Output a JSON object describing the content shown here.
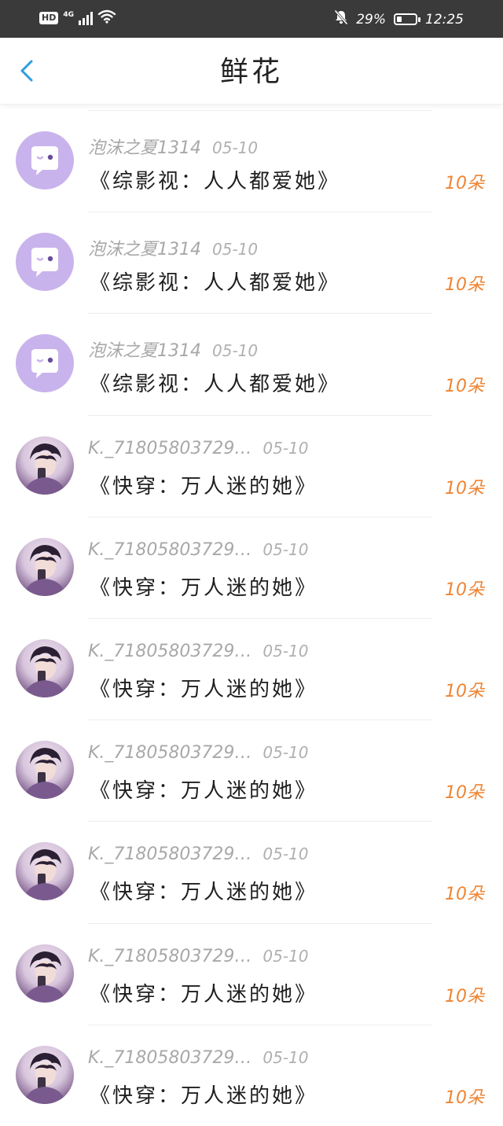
{
  "status_bar": {
    "hd": "HD",
    "network": "4G",
    "battery_percent": "29%",
    "battery_level": 0.29,
    "time": "12:25",
    "icons": [
      "hd-icon",
      "signal-icon",
      "wifi-icon",
      "bell-mute-icon",
      "battery-icon"
    ]
  },
  "header": {
    "title": "鲜花",
    "back_icon": "chevron-left-icon",
    "accent_color": "#2d9de0"
  },
  "colors": {
    "count_color": "#ef8433",
    "default_avatar_bg": "#c9b3ec"
  },
  "items": [
    {
      "user": "泡沫之夏1314",
      "date": "05-10",
      "book": "《综影视：人人都爱她》",
      "count": "10朵",
      "avatar": "default"
    },
    {
      "user": "泡沫之夏1314",
      "date": "05-10",
      "book": "《综影视：人人都爱她》",
      "count": "10朵",
      "avatar": "default"
    },
    {
      "user": "泡沫之夏1314",
      "date": "05-10",
      "book": "《综影视：人人都爱她》",
      "count": "10朵",
      "avatar": "default"
    },
    {
      "user": "K._71805803729…",
      "date": "05-10",
      "book": "《快穿：万人迷的她》",
      "count": "10朵",
      "avatar": "photo"
    },
    {
      "user": "K._71805803729…",
      "date": "05-10",
      "book": "《快穿：万人迷的她》",
      "count": "10朵",
      "avatar": "photo"
    },
    {
      "user": "K._71805803729…",
      "date": "05-10",
      "book": "《快穿：万人迷的她》",
      "count": "10朵",
      "avatar": "photo"
    },
    {
      "user": "K._71805803729…",
      "date": "05-10",
      "book": "《快穿：万人迷的她》",
      "count": "10朵",
      "avatar": "photo"
    },
    {
      "user": "K._71805803729…",
      "date": "05-10",
      "book": "《快穿：万人迷的她》",
      "count": "10朵",
      "avatar": "photo"
    },
    {
      "user": "K._71805803729…",
      "date": "05-10",
      "book": "《快穿：万人迷的她》",
      "count": "10朵",
      "avatar": "photo"
    },
    {
      "user": "K._71805803729…",
      "date": "05-10",
      "book": "《快穿：万人迷的她》",
      "count": "10朵",
      "avatar": "photo"
    }
  ]
}
